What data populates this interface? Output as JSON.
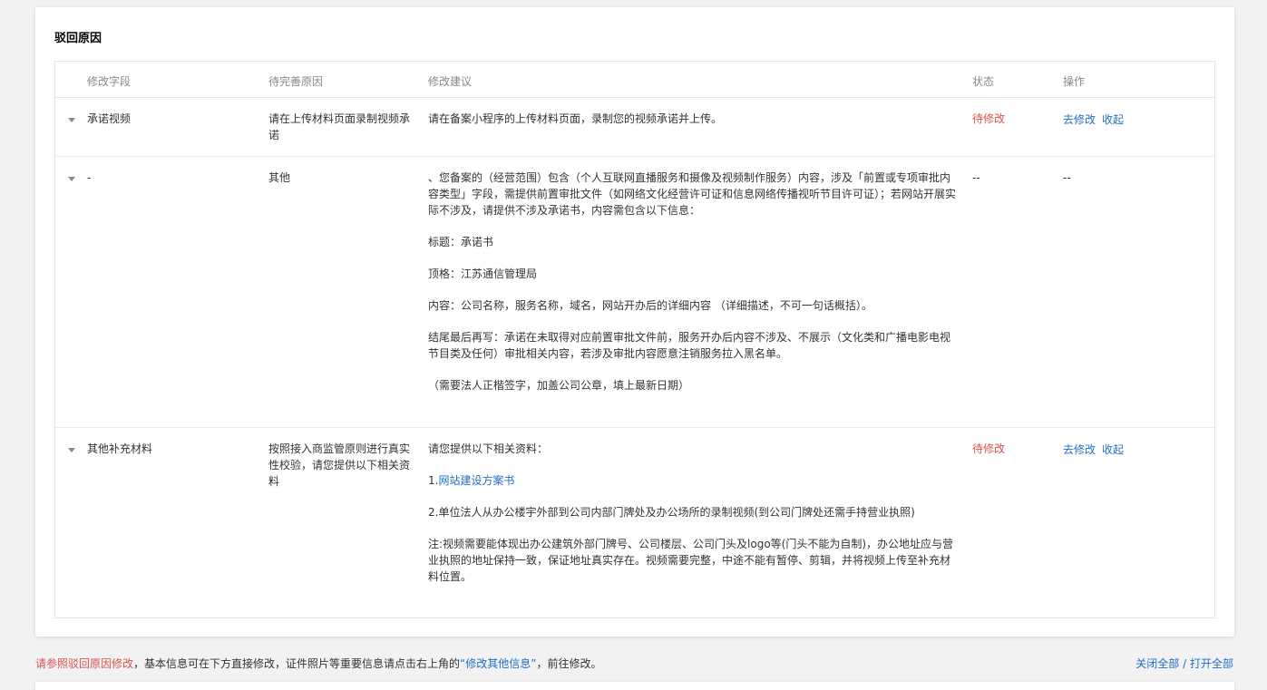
{
  "card": {
    "title": "驳回原因"
  },
  "table": {
    "headers": [
      "修改字段",
      "待完善原因",
      "修改建议",
      "状态",
      "操作"
    ],
    "rows": [
      {
        "field": "承诺视频",
        "reason": "请在上传材料页面录制视频承诺",
        "suggestion": [
          "请在备案小程序的上传材料页面，录制您的视频承诺并上传。"
        ],
        "status": "待修改",
        "ops": [
          "去修改",
          "收起"
        ]
      },
      {
        "field": "-",
        "reason": "其他",
        "suggestion": [
          "、您备案的（经营范围）包含（个人互联网直播服务和摄像及视频制作服务）内容，涉及「前置或专项审批内容类型」字段，需提供前置审批文件（如网络文化经营许可证和信息网络传播视听节目许可证）；若网站开展实际不涉及，请提供不涉及承诺书，内容需包含以下信息：",
          "标题：承诺书",
          "顶格：江苏通信管理局",
          "内容：公司名称，服务名称，域名，网站开办后的详细内容 （详细描述，不可一句话概括）。",
          "结尾最后再写：承诺在未取得对应前置审批文件前，服务开办后内容不涉及、不展示（文化类和广播电影电视节目类及任何）审批相关内容，若涉及审批内容愿意注销服务拉入黑名单。",
          "（需要法人正楷签字，加盖公司公章，填上最新日期）"
        ],
        "status": "--",
        "ops_text": "--"
      },
      {
        "field": "其他补充材料",
        "reason": "按照接入商监管原则进行真实性校验，请您提供以下相关资料",
        "suggestion_intro": "请您提供以下相关资料：",
        "suggestion_item1_prefix": "1.",
        "suggestion_item1_link": "网站建设方案书",
        "suggestion_item2": "2.单位法人从办公楼宇外部到公司内部门牌处及办公场所的录制视频(到公司门牌处还需手持营业执照)",
        "suggestion_note": "注:视频需要能体现出办公建筑外部门牌号、公司楼层、公司门头及logo等(门头不能为自制)，办公地址应与营业执照的地址保持一致，保证地址真实存在。视频需要完整，中途不能有暂停、剪辑，并将视频上传至补充材料位置。",
        "status": "待修改",
        "ops": [
          "去修改",
          "收起"
        ]
      }
    ]
  },
  "footer": {
    "red_text": "请参照驳回原因修改",
    "mid_text": "，基本信息可在下方直接修改，证件照片等重要信息请点击右上角的",
    "link_text": "“修改其他信息”",
    "end_text": "，前往修改。",
    "close_all": "关闭全部",
    "separator": " / ",
    "open_all": "打开全部"
  },
  "colors": {
    "pending": "#d9534f",
    "link": "#1f6fc5"
  }
}
